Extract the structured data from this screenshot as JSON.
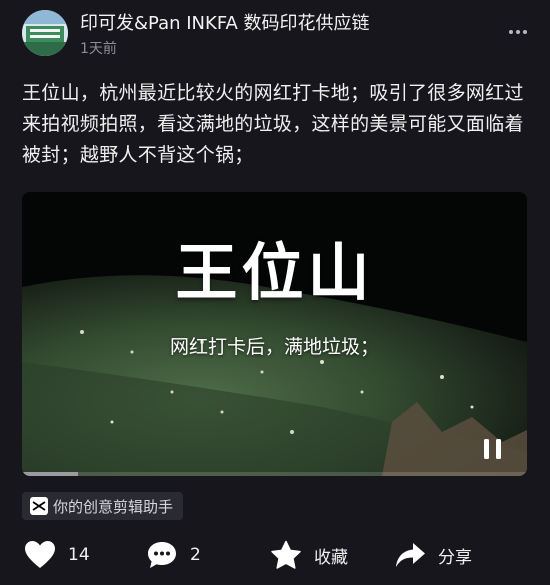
{
  "post": {
    "author": "印可发&Pan INKFA 数码印花供应链",
    "time": "1天前",
    "text": "王位山，杭州最近比较火的网红打卡地；吸引了很多网红过来拍视频拍照，看这满地的垃圾，这样的美景可能又面临着被封；越野人不背这个锅；"
  },
  "video": {
    "title": "王位山",
    "subtitle": "网红打卡后，满地垃圾；",
    "progress": 0.11
  },
  "app_tag": {
    "icon": "capcut-icon",
    "label": "你的创意剪辑助手"
  },
  "actions": {
    "like_count": "14",
    "comment_count": "2",
    "favorite_label": "收藏",
    "share_label": "分享"
  },
  "colors": {
    "background": "#16161c",
    "text": "#f0f0f0",
    "secondary_text": "#8c8c94",
    "tag_background": "#2a2a32"
  }
}
